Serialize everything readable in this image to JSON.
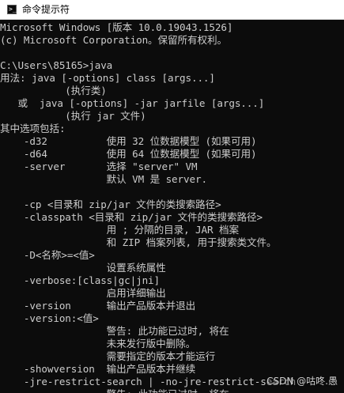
{
  "window": {
    "title": "命令提示符",
    "icon": "cmd-icon",
    "prompt_glyph": ">_"
  },
  "console": {
    "lines": [
      "Microsoft Windows [版本 10.0.19043.1526]",
      "(c) Microsoft Corporation。保留所有权利。",
      "",
      "C:\\Users\\85165>java",
      "用法: java [-options] class [args...]",
      "           (执行类)",
      "   或  java [-options] -jar jarfile [args...]",
      "           (执行 jar 文件)",
      "其中选项包括:",
      "    -d32          使用 32 位数据模型 (如果可用)",
      "    -d64          使用 64 位数据模型 (如果可用)",
      "    -server       选择 \"server\" VM",
      "                  默认 VM 是 server.",
      "",
      "    -cp <目录和 zip/jar 文件的类搜索路径>",
      "    -classpath <目录和 zip/jar 文件的类搜索路径>",
      "                  用 ; 分隔的目录, JAR 档案",
      "                  和 ZIP 档案列表, 用于搜索类文件。",
      "    -D<名称>=<值>",
      "                  设置系统属性",
      "    -verbose:[class|gc|jni]",
      "                  启用详细输出",
      "    -version      输出产品版本并退出",
      "    -version:<值>",
      "                  警告: 此功能已过时, 将在",
      "                  未来发行版中删除。",
      "                  需要指定的版本才能运行",
      "    -showversion  输出产品版本并继续",
      "    -jre-restrict-search | -no-jre-restrict-search",
      "                  警告: 此功能已过时, 将在"
    ]
  },
  "watermark": "CSDN @咕咚.愚",
  "colors": {
    "background": "#0c0c0c",
    "text": "#cccccc",
    "titlebar": "#ffffff"
  }
}
